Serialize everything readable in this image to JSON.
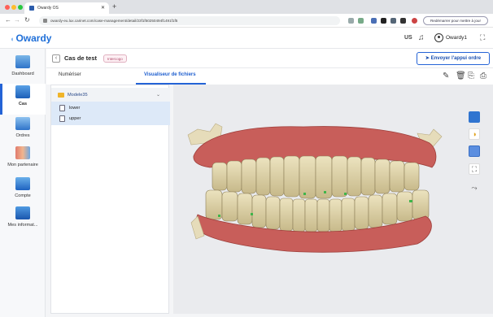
{
  "browser": {
    "tab_title": "Owardy OS",
    "url": "owardy-eu.lux.carinet.com/case-management/detail/23f1f50250494f1491f1f5",
    "restart_label": "Redémarrer pour mettre à jour"
  },
  "header": {
    "logo": "Owardy",
    "region": "US",
    "username": "Owardy1"
  },
  "sidebar": {
    "items": [
      {
        "label": "Dashboard",
        "icon": "dashboard-icon"
      },
      {
        "label": "Cas",
        "icon": "case-icon"
      },
      {
        "label": "Ordres",
        "icon": "orders-icon"
      },
      {
        "label": "Mon partenaire",
        "icon": "partner-icon"
      },
      {
        "label": "Compte",
        "icon": "account-icon"
      },
      {
        "label": "Mes informat...",
        "icon": "info-icon"
      }
    ]
  },
  "case": {
    "title": "Cas de test",
    "badge": "Intercogo",
    "send_button": "Envoyer l'appui ordre"
  },
  "tabs": [
    {
      "label": "Numériser",
      "active": false
    },
    {
      "label": "Visualiseur de fichiers",
      "active": true
    }
  ],
  "files": {
    "folder": "Modele35",
    "items": [
      "lower",
      "upper"
    ]
  },
  "colors": {
    "accent": "#2463d6",
    "gum": "#c85e5a",
    "tooth": "#ddd2a8"
  }
}
